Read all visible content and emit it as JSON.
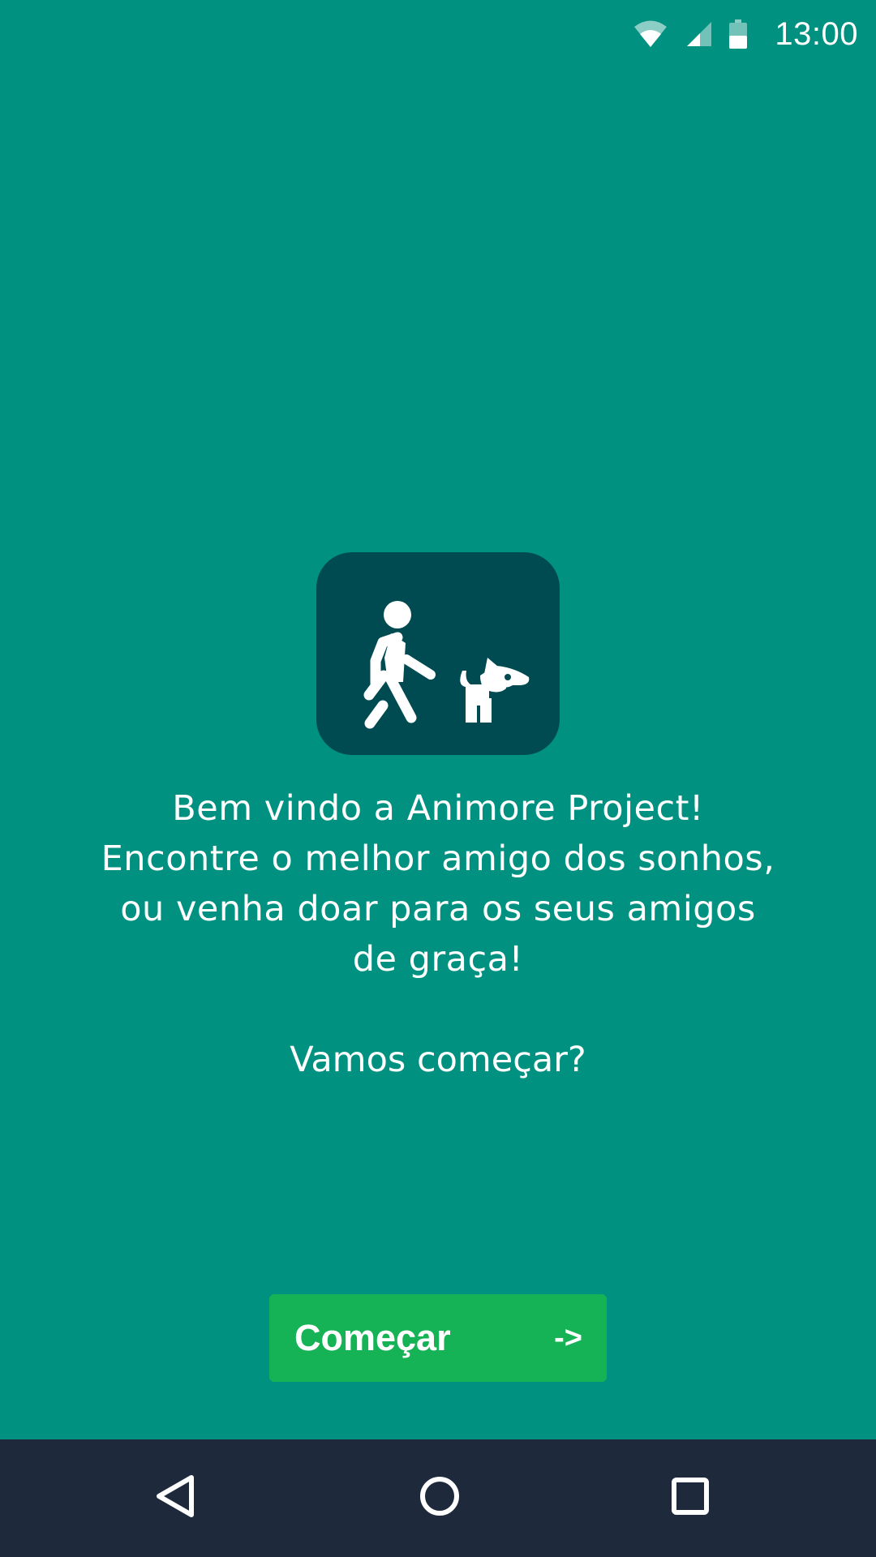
{
  "status_bar": {
    "time": "13:00",
    "icons": [
      "wifi-icon",
      "cell-signal-icon",
      "battery-icon"
    ]
  },
  "welcome": {
    "logo_icon": "person-walking-dog-icon",
    "lines": [
      "Bem vindo a Animore Project!",
      "Encontre o melhor amigo dos sonhos,",
      "ou venha doar para os seus amigos",
      "de graça!"
    ],
    "question": "Vamos começar?"
  },
  "start_button": {
    "label": "Começar",
    "arrow": "->"
  },
  "nav_bar": {
    "icons": [
      "back-icon",
      "home-icon",
      "recents-icon"
    ]
  },
  "colors": {
    "background": "#009181",
    "logo_tile": "#004b52",
    "button": "#16b356",
    "nav_bar": "#1e2a3c",
    "text": "#ffffff"
  }
}
